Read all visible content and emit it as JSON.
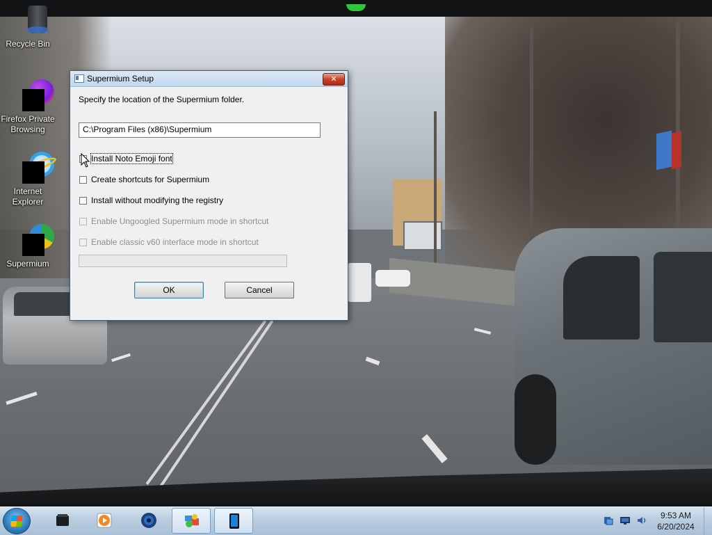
{
  "desktop": {
    "icons": [
      {
        "label": "Recycle Bin",
        "icon": "recycle-bin-icon"
      },
      {
        "label": "Firefox Private Browsing",
        "icon": "firefox-private-icon"
      },
      {
        "label": "Internet Explorer",
        "icon": "internet-explorer-icon"
      },
      {
        "label": "Supermium",
        "icon": "supermium-icon"
      }
    ]
  },
  "dialog": {
    "title": "Supermium Setup",
    "close_glyph": "✕",
    "instruction": "Specify the location of the Supermium folder.",
    "install_path": "C:\\Program Files (x86)\\Supermium",
    "options": [
      {
        "label": "Install Noto Emoji font",
        "checked": false,
        "enabled": true
      },
      {
        "label": "Create shortcuts for Supermium",
        "checked": false,
        "enabled": true
      },
      {
        "label": "Install without modifying the registry",
        "checked": false,
        "enabled": true
      },
      {
        "label": "Enable Ungoogled Supermium mode in shortcut",
        "checked": false,
        "enabled": false
      },
      {
        "label": "Enable classic v60 interface mode in shortcut",
        "checked": false,
        "enabled": false
      }
    ],
    "progress": 0,
    "ok_label": "OK",
    "cancel_label": "Cancel"
  },
  "taskbar": {
    "pinned": [
      "file-manager-icon",
      "media-player-icon",
      "browser-icon",
      "control-panel-icon",
      "supermium-setup-icon"
    ],
    "tray": [
      "network-icon",
      "display-icon",
      "volume-icon"
    ],
    "clock": {
      "time": "9:53 AM",
      "date": "6/20/2024"
    }
  },
  "colors": {
    "taskbar": "#b9cde0",
    "dialog_bg": "#f0f0f0",
    "close_button": "#c6422c"
  }
}
